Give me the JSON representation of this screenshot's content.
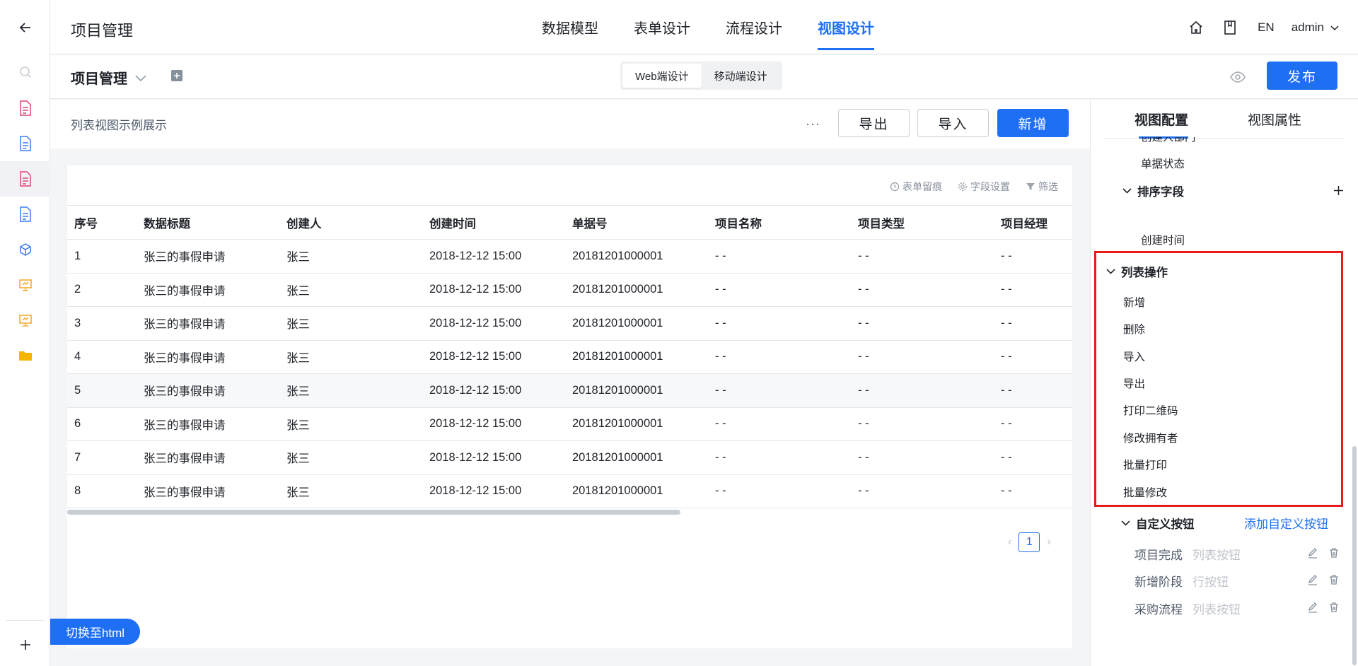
{
  "header": {
    "app_title": "项目管理",
    "tabs": [
      {
        "label": "数据模型",
        "active": false
      },
      {
        "label": "表单设计",
        "active": false
      },
      {
        "label": "流程设计",
        "active": false
      },
      {
        "label": "视图设计",
        "active": true
      }
    ],
    "lang": "EN",
    "user": "admin",
    "accent_color": "#1f6ff5"
  },
  "subbar": {
    "title": "项目管理",
    "device_options": [
      "Web端设计",
      "移动端设计"
    ],
    "active_device": "Web端设计",
    "publish_label": "发布"
  },
  "main": {
    "view_title": "列表视图示例展示",
    "more_label": "···",
    "export_label": "导出",
    "import_label": "导入",
    "add_label": "新增",
    "tools": [
      "表单留痕",
      "字段设置",
      "筛选"
    ],
    "table": {
      "columns": [
        "序号",
        "数据标题",
        "创建人",
        "创建时间",
        "单据号",
        "项目名称",
        "项目类型",
        "项目经理"
      ],
      "rows": [
        [
          "1",
          "张三的事假申请",
          "张三",
          "2018-12-12 15:00",
          "20181201000001",
          "- -",
          "- -",
          "- -"
        ],
        [
          "2",
          "张三的事假申请",
          "张三",
          "2018-12-12 15:00",
          "20181201000001",
          "- -",
          "- -",
          "- -"
        ],
        [
          "3",
          "张三的事假申请",
          "张三",
          "2018-12-12 15:00",
          "20181201000001",
          "- -",
          "- -",
          "- -"
        ],
        [
          "4",
          "张三的事假申请",
          "张三",
          "2018-12-12 15:00",
          "20181201000001",
          "- -",
          "- -",
          "- -"
        ],
        [
          "5",
          "张三的事假申请",
          "张三",
          "2018-12-12 15:00",
          "20181201000001",
          "- -",
          "- -",
          "- -"
        ],
        [
          "6",
          "张三的事假申请",
          "张三",
          "2018-12-12 15:00",
          "20181201000001",
          "- -",
          "- -",
          "- -"
        ],
        [
          "7",
          "张三的事假申请",
          "张三",
          "2018-12-12 15:00",
          "20181201000001",
          "- -",
          "- -",
          "- -"
        ],
        [
          "8",
          "张三的事假申请",
          "张三",
          "2018-12-12 15:00",
          "20181201000001",
          "- -",
          "- -",
          "- -"
        ]
      ]
    },
    "page": "1",
    "switch_html_label": "切换至html"
  },
  "panel": {
    "tabs": [
      "视图配置",
      "视图属性"
    ],
    "cut_item": "创建人部门",
    "status_item": "单据状态",
    "sort_section": "排序字段",
    "sort_items": [
      "创建时间"
    ],
    "list_ops_section": "列表操作",
    "list_ops": [
      "新增",
      "删除",
      "导入",
      "导出",
      "打印二维码",
      "修改拥有者",
      "批量打印",
      "批量修改"
    ],
    "custom_section": "自定义按钮",
    "add_custom_label": "添加自定义按钮",
    "custom_buttons": [
      {
        "name": "项目完成",
        "type": "列表按钮"
      },
      {
        "name": "新增阶段",
        "type": "行按钮"
      },
      {
        "name": "采购流程",
        "type": "列表按钮"
      }
    ]
  }
}
